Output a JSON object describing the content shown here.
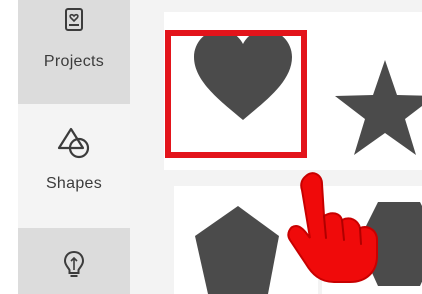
{
  "sidebar": {
    "items": [
      {
        "label": "Projects",
        "icon": "project-board-icon"
      },
      {
        "label": "Shapes",
        "icon": "shapes-icon"
      },
      {
        "label": "",
        "icon": "lightbulb-icon"
      }
    ]
  },
  "shapes_grid": {
    "tiles": [
      {
        "shape": "heart-icon",
        "selected": true
      },
      {
        "shape": "star-icon",
        "selected": false
      },
      {
        "shape": "pentagon-icon",
        "selected": false
      },
      {
        "shape": "hexagon-icon",
        "selected": false
      }
    ]
  },
  "colors": {
    "shape_fill": "#4b4b4b",
    "highlight": "#e3141b",
    "sidebar_active": "#f4f4f4",
    "sidebar_inactive": "#dcdcdc",
    "content_bg": "#f3f3f3"
  },
  "overlay": {
    "cursor": "pointing-hand-icon"
  }
}
